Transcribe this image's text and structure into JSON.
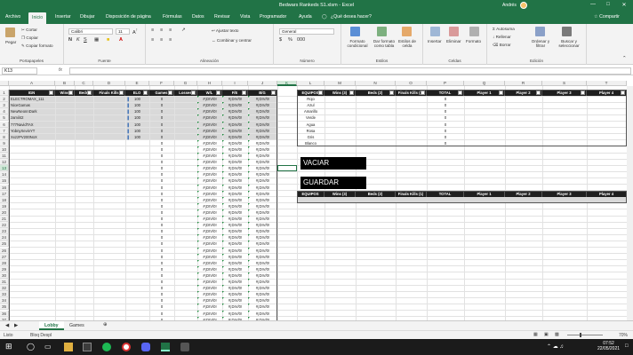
{
  "titlebar": {
    "title": "Bedwars Rankeds S1.xlsm  -  Excel",
    "user": "Andrés"
  },
  "menu": {
    "tabs": [
      "Archivo",
      "Inicio",
      "Insertar",
      "Dibujar",
      "Disposición de página",
      "Fórmulas",
      "Datos",
      "Revisar",
      "Vista",
      "Programador",
      "Ayuda"
    ],
    "tellme": "¿Qué desea hacer?",
    "share": "Compartir"
  },
  "ribbon": {
    "clipboard": {
      "paste": "Pegar",
      "cut": "Cortar",
      "copy": "Copiar",
      "format_painter": "Copiar formato",
      "label": "Portapapeles"
    },
    "font": {
      "name": "Calibri",
      "size": "11",
      "label": "Fuente"
    },
    "alignment": {
      "wrap": "Ajustar texto",
      "merge": "Combinar y centrar",
      "label": "Alineación"
    },
    "number": {
      "format": "General",
      "label": "Número"
    },
    "styles": {
      "conditional": "Formato condicional",
      "table": "Dar formato como tabla",
      "cell_styles": "Estilos de celda",
      "label": "Estilos"
    },
    "cells": {
      "insert": "Insertar",
      "delete": "Eliminar",
      "format": "Formato",
      "label": "Celdas"
    },
    "editing": {
      "autosum": "Autosuma",
      "fill": "Rellenar",
      "clear": "Borrar",
      "sort": "Ordenar y filtrar",
      "find": "Buscar y seleccionar",
      "label": "Edición"
    }
  },
  "formula_bar": {
    "name_box": "K13",
    "fx": "fx",
    "value": ""
  },
  "columns": [
    "A",
    "B",
    "C",
    "D",
    "E",
    "F",
    "G",
    "H",
    "I",
    "J",
    "K",
    "L",
    "M",
    "N",
    "O",
    "P",
    "Q",
    "R",
    "S",
    "T"
  ],
  "main_table": {
    "headers": [
      "IGN",
      "Wins",
      "Beds",
      "Finals Kills",
      "ELO",
      "Games",
      "Losses",
      "W/L",
      "F/E",
      "B/G"
    ],
    "players": [
      "ELECTROMAX_111",
      "NiceGamas",
      "NewNeonnDark",
      "zamil42",
      "777NavidTAX",
      "YobnyXevinYT",
      "XxzzPV200NoX"
    ],
    "elo": "100",
    "zero": "0",
    "div": "#¡DIV/0!"
  },
  "teams_table": {
    "headers": [
      "EQUIPOS",
      "Wins (3)",
      "Beds (2)",
      "Finals Kills (1)",
      "TOTAL",
      "Player 1",
      "Player 2",
      "Player 3",
      "Player 4"
    ],
    "teams": [
      "Rojo",
      "Azul",
      "Amarillo",
      "Verde",
      "Agua",
      "Rosa",
      "Gris",
      "Blanco"
    ],
    "zero": "0"
  },
  "buttons": {
    "empty": "VACIAR",
    "save": "GUARDAR"
  },
  "summary_table": {
    "headers": [
      "EQUIPOS",
      "Wins (3)",
      "Beds (2)",
      "Finals Kills (1)",
      "TOTAL",
      "Player 1",
      "Player 2",
      "Player 3",
      "Player 4"
    ],
    "zero": "0"
  },
  "sheets": [
    "Lobby",
    "Games"
  ],
  "status": {
    "ready": "Listo",
    "caps": "Bloq Despl",
    "zoom": "70%"
  },
  "clock": {
    "time": "07:52",
    "date": "22/05/2021"
  }
}
